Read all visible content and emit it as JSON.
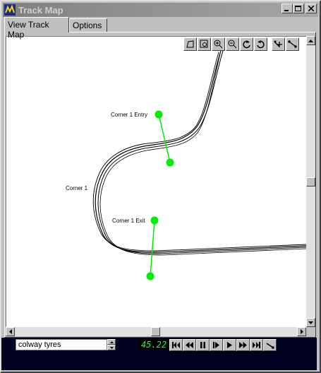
{
  "window": {
    "title": "Track Map"
  },
  "tabs": [
    {
      "label": "View Track Map",
      "active": true
    },
    {
      "label": "Options",
      "active": false
    }
  ],
  "toolbar": {
    "icons": [
      "select-region-icon",
      "zoom-box-icon",
      "zoom-in-icon",
      "zoom-out-icon",
      "rotate-left-icon",
      "rotate-right-icon",
      "add-marker-icon",
      "link-markers-icon"
    ]
  },
  "track_map": {
    "markers": [
      {
        "label": "Corner 1 Entry"
      },
      {
        "label": "Corner 1"
      },
      {
        "label": "Corner 1 Exit"
      }
    ],
    "marker_color": "#00ee00",
    "track_color": "#000000"
  },
  "dataset": {
    "value": "colway tyres"
  },
  "playback": {
    "time": "45.22",
    "time_color": "#1cff3c",
    "buttons": [
      "skip-to-start-icon",
      "rewind-icon",
      "pause-icon",
      "step-forward-icon",
      "play-icon",
      "fast-forward-icon",
      "skip-to-end-icon",
      "cursor-tool-icon"
    ]
  }
}
